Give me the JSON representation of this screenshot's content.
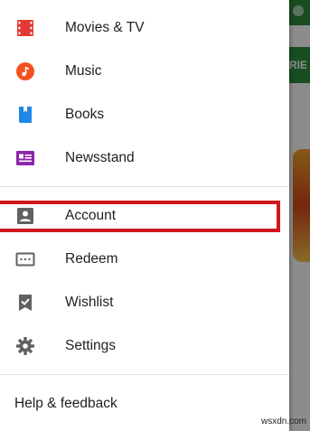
{
  "drawer": {
    "items": [
      {
        "label": "Movies & TV",
        "icon": "movies-tv-icon",
        "color": "#e53935"
      },
      {
        "label": "Music",
        "icon": "music-icon",
        "color": "#f4511e"
      },
      {
        "label": "Books",
        "icon": "books-icon",
        "color": "#1e88e5"
      },
      {
        "label": "Newsstand",
        "icon": "newsstand-icon",
        "color": "#8e24aa"
      },
      {
        "label": "Account",
        "icon": "account-icon",
        "color": "#616161"
      },
      {
        "label": "Redeem",
        "icon": "redeem-icon",
        "color": "#616161"
      },
      {
        "label": "Wishlist",
        "icon": "wishlist-icon",
        "color": "#616161"
      },
      {
        "label": "Settings",
        "icon": "settings-icon",
        "color": "#616161"
      }
    ],
    "help": "Help & feedback"
  },
  "background": {
    "tab_text": "RIE"
  },
  "annotation": {
    "highlight_color": "#d0171c"
  },
  "watermark": "wsxdn.com"
}
